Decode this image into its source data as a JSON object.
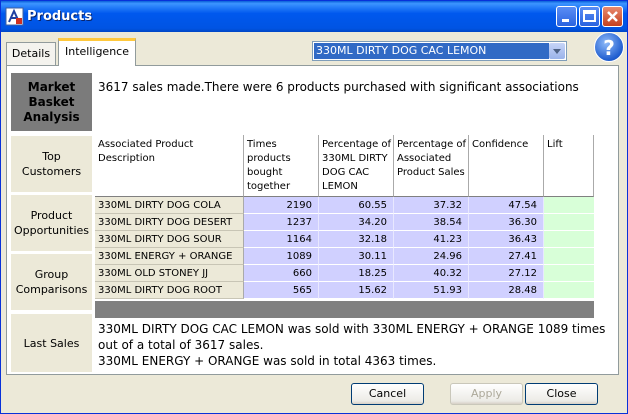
{
  "window": {
    "title": "Products"
  },
  "tabs": [
    {
      "label": "Details"
    },
    {
      "label": "Intelligence"
    }
  ],
  "product_select": {
    "value": "330ML DIRTY DOG CAC LEMON"
  },
  "help": {
    "label": "?"
  },
  "sidebar": [
    {
      "label": "Market Basket Analysis"
    },
    {
      "label": "Top Customers"
    },
    {
      "label": "Product Opportunities"
    },
    {
      "label": "Group Comparisons"
    },
    {
      "label": "Last Sales"
    }
  ],
  "summary": "3617 sales made.There were 6 products purchased with significant associations",
  "table": {
    "headers": [
      "Associated Product Description",
      "Times products bought together",
      "Percentage of 330ML DIRTY DOG CAC LEMON",
      "Percentage of Associated Product Sales",
      "Confidence",
      "Lift"
    ],
    "rows": [
      [
        "330ML DIRTY DOG COLA",
        "2190",
        "60.55",
        "37.32",
        "47.54",
        ""
      ],
      [
        "330ML DIRTY DOG DESERT",
        "1237",
        "34.20",
        "38.54",
        "36.30",
        ""
      ],
      [
        "330ML DIRTY DOG SOUR",
        "1164",
        "32.18",
        "41.23",
        "36.43",
        ""
      ],
      [
        "330ML ENERGY + ORANGE",
        "1089",
        "30.11",
        "24.96",
        "27.41",
        ""
      ],
      [
        "330ML OLD STONEY JJ",
        "660",
        "18.25",
        "40.32",
        "27.12",
        ""
      ],
      [
        "330ML DIRTY DOG ROOT",
        "565",
        "15.62",
        "51.93",
        "28.48",
        ""
      ]
    ]
  },
  "last_sales": {
    "line1": "330ML DIRTY DOG CAC LEMON was sold with 330ML ENERGY + ORANGE 1089 times",
    "line2": "out of a total of 3617 sales.",
    "line3": "330ML ENERGY + ORANGE was sold in total 4363 times."
  },
  "buttons": {
    "cancel": "Cancel",
    "apply": "Apply",
    "close": "Close"
  }
}
